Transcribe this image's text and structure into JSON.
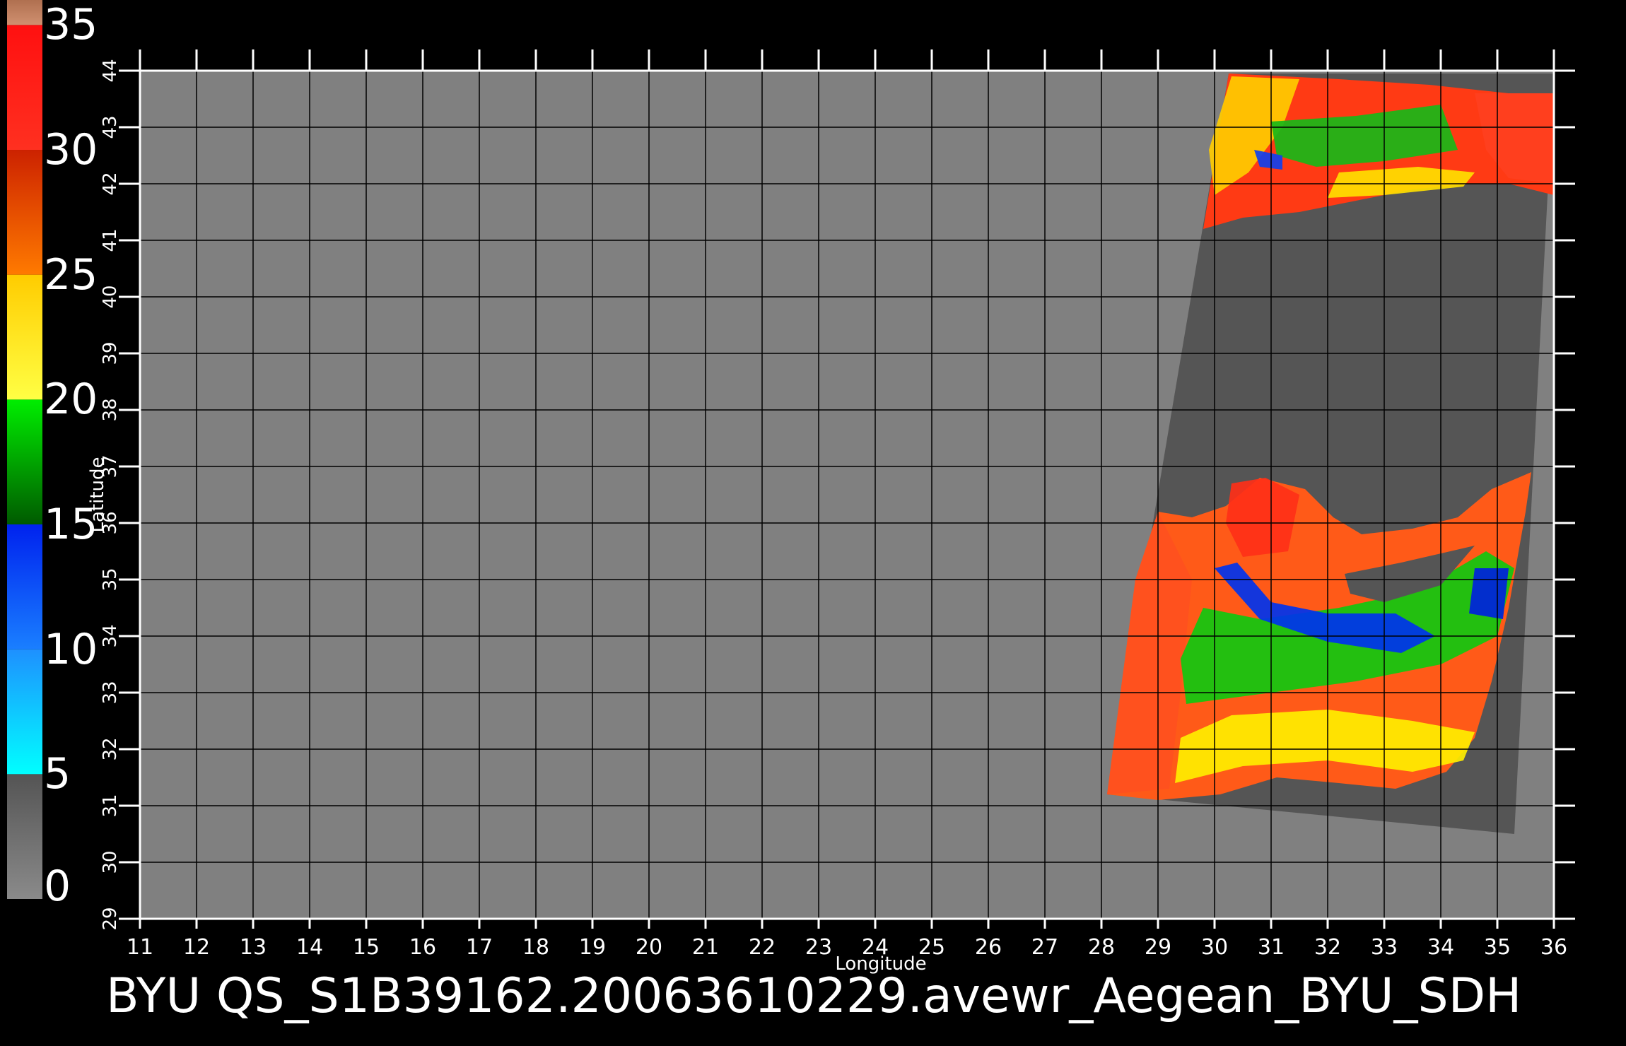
{
  "colorbar": {
    "segments": [
      {
        "from": 0,
        "to": 5,
        "top": "#545454",
        "bottom": "#8a8a8a"
      },
      {
        "from": 5,
        "to": 10,
        "top": "#1e90ff",
        "bottom": "#00ffff"
      },
      {
        "from": 10,
        "to": 15,
        "top": "#0022ee",
        "bottom": "#1a7fff"
      },
      {
        "from": 15,
        "to": 20,
        "top": "#00ee00",
        "bottom": "#005a00"
      },
      {
        "from": 20,
        "to": 25,
        "top": "#ffcc00",
        "bottom": "#ffff44"
      },
      {
        "from": 25,
        "to": 30,
        "top": "#cc2200",
        "bottom": "#ff7a00"
      },
      {
        "from": 30,
        "to": 35,
        "top": "#ff1010",
        "bottom": "#ff3020"
      },
      {
        "from": 35,
        "to": 36,
        "top": "#b07050",
        "bottom": "#d09070"
      }
    ],
    "ticks": [
      {
        "value": 35,
        "label": "35"
      },
      {
        "value": 30,
        "label": "30"
      },
      {
        "value": 25,
        "label": "25"
      },
      {
        "value": 20,
        "label": "20"
      },
      {
        "value": 15,
        "label": "15"
      },
      {
        "value": 10,
        "label": "10"
      },
      {
        "value": 5,
        "label": "5"
      },
      {
        "value": 0,
        "label": "0"
      }
    ]
  },
  "map": {
    "background_color": "#808080",
    "grid_color": "#000000",
    "lon_range": [
      11,
      36
    ],
    "lat_range": [
      29,
      44
    ],
    "lon_ticks": [
      "11",
      "12",
      "13",
      "14",
      "15",
      "16",
      "17",
      "18",
      "19",
      "20",
      "21",
      "22",
      "23",
      "24",
      "25",
      "26",
      "27",
      "28",
      "29",
      "30",
      "31",
      "32",
      "33",
      "34",
      "35",
      "36"
    ],
    "lat_ticks": [
      "29",
      "30",
      "31",
      "32",
      "33",
      "34",
      "35",
      "36",
      "37",
      "38",
      "39",
      "40",
      "41",
      "42",
      "43",
      "44"
    ],
    "xlabel": "Longitude",
    "ylabel": "Latitude",
    "swath_color": "#555555",
    "swath": [
      [
        30.25,
        43.95
      ],
      [
        36.0,
        43.95
      ],
      [
        35.3,
        30.5
      ],
      [
        28.1,
        31.2
      ]
    ],
    "land_north": [
      [
        29.8,
        41.2
      ],
      [
        30.5,
        41.4
      ],
      [
        31.5,
        41.5
      ],
      [
        32.5,
        41.7
      ],
      [
        33.5,
        41.9
      ],
      [
        34.5,
        42.0
      ],
      [
        35.2,
        42.0
      ],
      [
        36.0,
        41.8
      ],
      [
        36.0,
        43.6
      ],
      [
        35.2,
        43.6
      ],
      [
        33.8,
        43.75
      ],
      [
        32.2,
        43.85
      ],
      [
        30.25,
        43.95
      ]
    ],
    "land_south": [
      [
        28.1,
        31.2
      ],
      [
        28.6,
        35.0
      ],
      [
        29.0,
        36.2
      ],
      [
        29.6,
        36.1
      ],
      [
        30.2,
        36.3
      ],
      [
        30.8,
        36.8
      ],
      [
        31.6,
        36.6
      ],
      [
        32.1,
        36.1
      ],
      [
        32.6,
        35.8
      ],
      [
        33.5,
        35.9
      ],
      [
        34.3,
        36.1
      ],
      [
        34.9,
        36.6
      ],
      [
        35.6,
        36.9
      ],
      [
        35.5,
        36.2
      ],
      [
        35.2,
        34.5
      ],
      [
        34.9,
        33.2
      ],
      [
        34.6,
        32.2
      ],
      [
        34.1,
        31.6
      ],
      [
        33.2,
        31.3
      ],
      [
        32.2,
        31.4
      ],
      [
        31.1,
        31.5
      ],
      [
        30.1,
        31.2
      ],
      [
        29.0,
        31.1
      ]
    ],
    "cyprus": [
      [
        32.3,
        35.1
      ],
      [
        33.3,
        35.3
      ],
      [
        34.6,
        35.6
      ],
      [
        34.0,
        34.9
      ],
      [
        33.0,
        34.6
      ],
      [
        32.4,
        34.75
      ]
    ],
    "wind_color_fields": [
      {
        "color": "#ff5020",
        "poly": [
          [
            28.1,
            31.2
          ],
          [
            28.6,
            35.0
          ],
          [
            29.0,
            36.2
          ],
          [
            29.6,
            35.0
          ],
          [
            29.4,
            33.0
          ],
          [
            29.2,
            31.3
          ]
        ]
      },
      {
        "color": "#ff3018",
        "poly": [
          [
            30.3,
            36.7
          ],
          [
            30.9,
            36.8
          ],
          [
            31.5,
            36.5
          ],
          [
            31.3,
            35.5
          ],
          [
            30.5,
            35.4
          ],
          [
            30.2,
            36.0
          ]
        ]
      },
      {
        "color": "#ffee00",
        "poly": [
          [
            29.3,
            31.4
          ],
          [
            30.5,
            31.7
          ],
          [
            32.0,
            31.8
          ],
          [
            33.5,
            31.6
          ],
          [
            34.4,
            31.8
          ],
          [
            34.6,
            32.3
          ],
          [
            33.5,
            32.5
          ],
          [
            32.0,
            32.7
          ],
          [
            30.3,
            32.6
          ],
          [
            29.4,
            32.2
          ]
        ]
      },
      {
        "color": "#10c810",
        "poly": [
          [
            29.5,
            32.8
          ],
          [
            31.0,
            33.0
          ],
          [
            32.5,
            33.2
          ],
          [
            34.0,
            33.5
          ],
          [
            35.0,
            34.0
          ],
          [
            35.3,
            35.2
          ],
          [
            34.8,
            35.5
          ],
          [
            33.6,
            34.8
          ],
          [
            32.2,
            34.5
          ],
          [
            30.8,
            34.3
          ],
          [
            29.8,
            34.5
          ],
          [
            29.4,
            33.6
          ]
        ]
      },
      {
        "color": "#0033ee",
        "poly": [
          [
            30.0,
            35.2
          ],
          [
            30.8,
            34.3
          ],
          [
            32.0,
            33.9
          ],
          [
            33.3,
            33.7
          ],
          [
            33.9,
            34.0
          ],
          [
            33.2,
            34.4
          ],
          [
            32.0,
            34.4
          ],
          [
            31.0,
            34.6
          ],
          [
            30.4,
            35.3
          ]
        ]
      },
      {
        "color": "#0022dd",
        "poly": [
          [
            34.5,
            34.4
          ],
          [
            35.1,
            34.3
          ],
          [
            35.2,
            35.2
          ],
          [
            34.6,
            35.2
          ]
        ]
      },
      {
        "color": "#ffcc00",
        "poly": [
          [
            30.3,
            43.9
          ],
          [
            31.5,
            43.85
          ],
          [
            31.2,
            43.0
          ],
          [
            30.6,
            42.2
          ],
          [
            30.0,
            41.8
          ],
          [
            29.9,
            42.6
          ]
        ]
      },
      {
        "color": "#18b818",
        "poly": [
          [
            31.0,
            43.1
          ],
          [
            32.5,
            43.2
          ],
          [
            34.0,
            43.4
          ],
          [
            34.3,
            42.6
          ],
          [
            33.0,
            42.4
          ],
          [
            31.8,
            42.3
          ],
          [
            31.1,
            42.5
          ]
        ]
      },
      {
        "color": "#ff4020",
        "poly": [
          [
            34.6,
            43.6
          ],
          [
            36.0,
            43.6
          ],
          [
            36.0,
            42.0
          ],
          [
            35.2,
            42.1
          ],
          [
            34.8,
            42.6
          ]
        ]
      },
      {
        "color": "#ffe000",
        "poly": [
          [
            32.2,
            42.2
          ],
          [
            33.6,
            42.3
          ],
          [
            34.6,
            42.2
          ],
          [
            34.4,
            41.95
          ],
          [
            33.0,
            41.8
          ],
          [
            32.0,
            41.75
          ]
        ]
      },
      {
        "color": "#1040ee",
        "poly": [
          [
            30.7,
            42.6
          ],
          [
            31.2,
            42.5
          ],
          [
            31.2,
            42.25
          ],
          [
            30.8,
            42.3
          ]
        ]
      }
    ]
  },
  "caption": "BYU  QS_S1B39162.20063610229.avewr_Aegean_BYU_SDH"
}
